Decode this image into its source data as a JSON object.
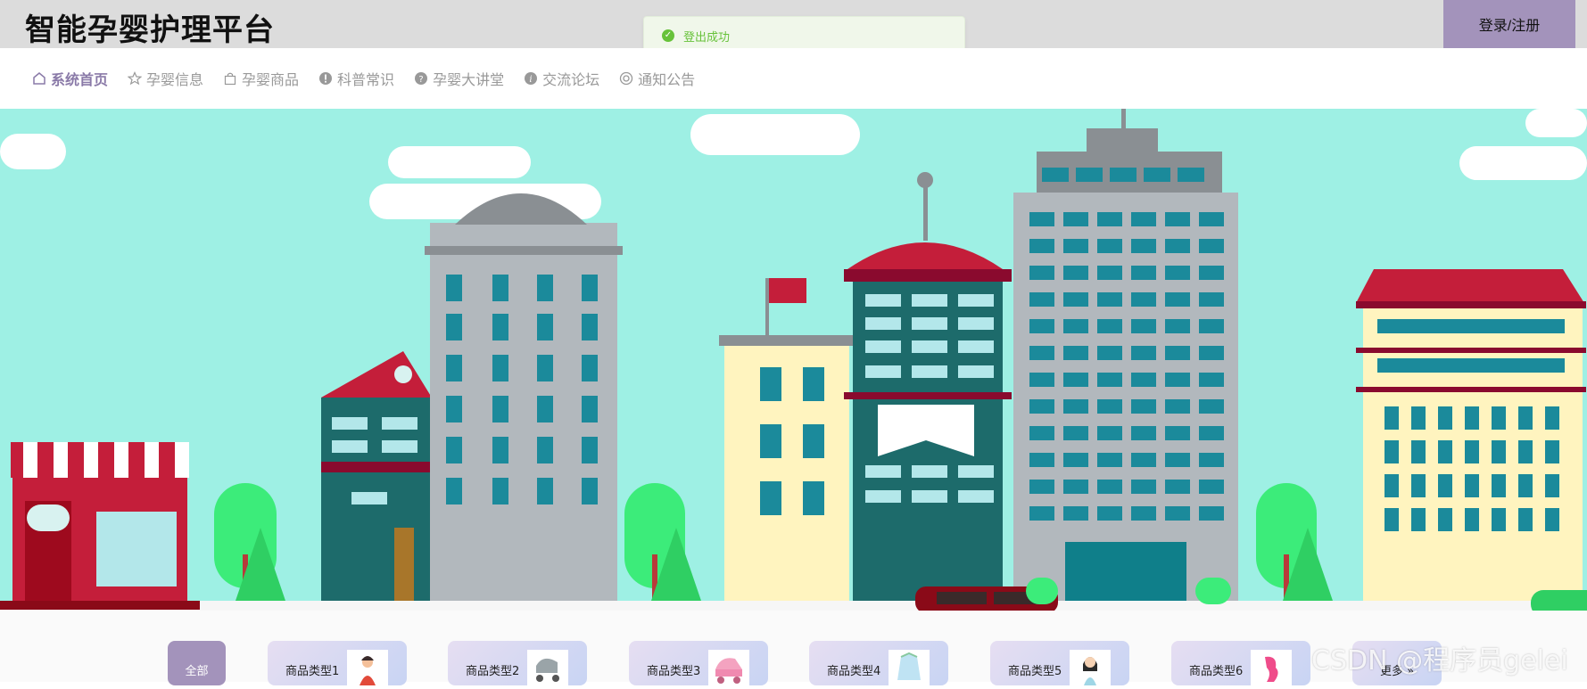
{
  "header": {
    "title": "智能孕婴护理平台",
    "login_label": "登录/注册"
  },
  "toast": {
    "message": "登出成功"
  },
  "nav": {
    "items": [
      {
        "label": "系统首页",
        "icon": "home-icon",
        "active": true
      },
      {
        "label": "孕婴信息",
        "icon": "star-icon"
      },
      {
        "label": "孕婴商品",
        "icon": "bag-icon"
      },
      {
        "label": "科普常识",
        "icon": "info-icon"
      },
      {
        "label": "孕婴大讲堂",
        "icon": "question-icon"
      },
      {
        "label": "交流论坛",
        "icon": "info-circle-icon"
      },
      {
        "label": "通知公告",
        "icon": "bell-icon"
      }
    ]
  },
  "categories": {
    "all_label": "全部",
    "items": [
      "商品类型1",
      "商品类型2",
      "商品类型3",
      "商品类型4",
      "商品类型5",
      "商品类型6"
    ],
    "more_label": "更多 »"
  },
  "watermark": "CSDN @程序员gelei",
  "colors": {
    "accent": "#a393bb",
    "success": "#67c23a",
    "sky": "#9ef0e4",
    "topbar": "#dcdcdc"
  }
}
